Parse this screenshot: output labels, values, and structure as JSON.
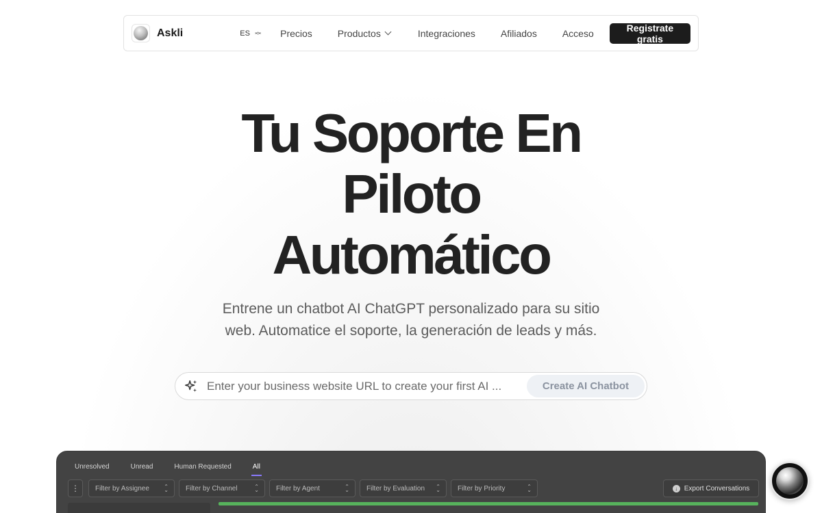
{
  "nav": {
    "brand": "Askli",
    "language": "ES",
    "links": [
      "Precios",
      "Productos",
      "Integraciones",
      "Afiliados",
      "Acceso"
    ],
    "cta": "Registrate gratis"
  },
  "hero": {
    "title_line1": "Tu Soporte En",
    "title_line2": "Piloto",
    "title_line3": "Automático",
    "subtitle_line1": "Entrene un chatbot AI ChatGPT personalizado para su sitio",
    "subtitle_line2": "web. Automatice el soporte, la generación de leads y más."
  },
  "url_form": {
    "placeholder": "Enter your business website URL to create your first AI ...",
    "button": "Create AI Chatbot"
  },
  "dashboard": {
    "tabs": [
      "Unresolved",
      "Unread",
      "Human Requested",
      "All"
    ],
    "active_tab": "All",
    "filters": [
      "Filter by Assignee",
      "Filter by Channel",
      "Filter by Agent",
      "Filter by Evaluation",
      "Filter by Priority"
    ],
    "export_button": "Export Conversations"
  },
  "colors": {
    "cta_bg": "#1c1c1c",
    "dashboard_bg": "#434343",
    "accent_tab": "#8b7bff",
    "progress": "#57b35c"
  }
}
